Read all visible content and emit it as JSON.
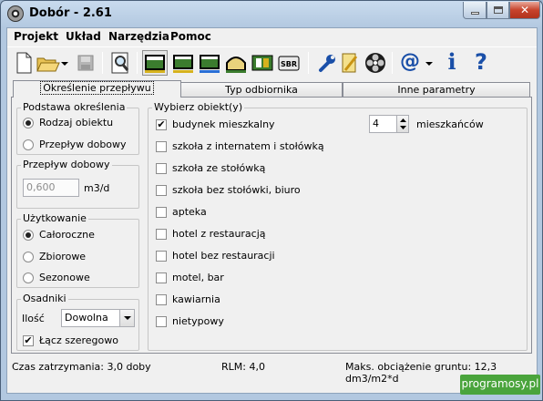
{
  "window": {
    "title": "Dobór - 2.61"
  },
  "menu": [
    "Projekt",
    "Układ",
    "Narzędzia",
    "Pomoc"
  ],
  "toolbar": {
    "buttons": [
      "new-file-icon",
      "open-folder-icon",
      "dropdown-arrow-icon",
      "save-disk-icon",
      "magnifier-icon",
      "tank-section-1-icon",
      "tank-section-2-icon",
      "tank-section-3-icon",
      "tunnel-icon",
      "filter-device-icon",
      "sbr-icon",
      "wrench-icon",
      "pencil-note-icon",
      "flower-icon",
      "at-sign-icon",
      "info-icon",
      "help-icon"
    ],
    "sbr_label": "SBR",
    "at": "@",
    "info": "i",
    "help": "?"
  },
  "tabs": [
    "Określenie przepływu",
    "Typ odbiornika",
    "Inne parametry"
  ],
  "basis": {
    "label": "Podstawa określenia",
    "options": [
      "Rodzaj obiektu",
      "Przepływ dobowy"
    ],
    "selected": 0
  },
  "flow": {
    "label": "Przepływ dobowy",
    "value": "0,600",
    "unit": "m3/d"
  },
  "usage": {
    "label": "Użytkowanie",
    "options": [
      "Całoroczne",
      "Zbiorowe",
      "Sezonowe"
    ],
    "selected": 0
  },
  "settlers": {
    "label": "Osadniki",
    "qty_label": "Ilość",
    "qty_value": "Dowolna",
    "series_label": "Łącz szeregowo",
    "series_checked": true
  },
  "objects": {
    "label": "Wybierz obiekt(y)",
    "items": [
      {
        "label": "budynek mieszkalny",
        "checked": true
      },
      {
        "label": "szkoła z internatem i stołówką",
        "checked": false
      },
      {
        "label": "szkoła ze stołówką",
        "checked": false
      },
      {
        "label": "szkoła bez stołówki, biuro",
        "checked": false
      },
      {
        "label": "apteka",
        "checked": false
      },
      {
        "label": "hotel z restauracją",
        "checked": false
      },
      {
        "label": "hotel bez restauracji",
        "checked": false
      },
      {
        "label": "motel, bar",
        "checked": false
      },
      {
        "label": "kawiarnia",
        "checked": false
      },
      {
        "label": "nietypowy",
        "checked": false
      }
    ],
    "count": "4",
    "count_unit": "mieszkańców"
  },
  "status": {
    "retention": "Czas zatrzymania: 3,0 doby",
    "rlm": "RLM: 4,0",
    "load": "Maks. obciążenie gruntu: 12,3 dm3/m2*d"
  },
  "watermark": "programosy.pl"
}
